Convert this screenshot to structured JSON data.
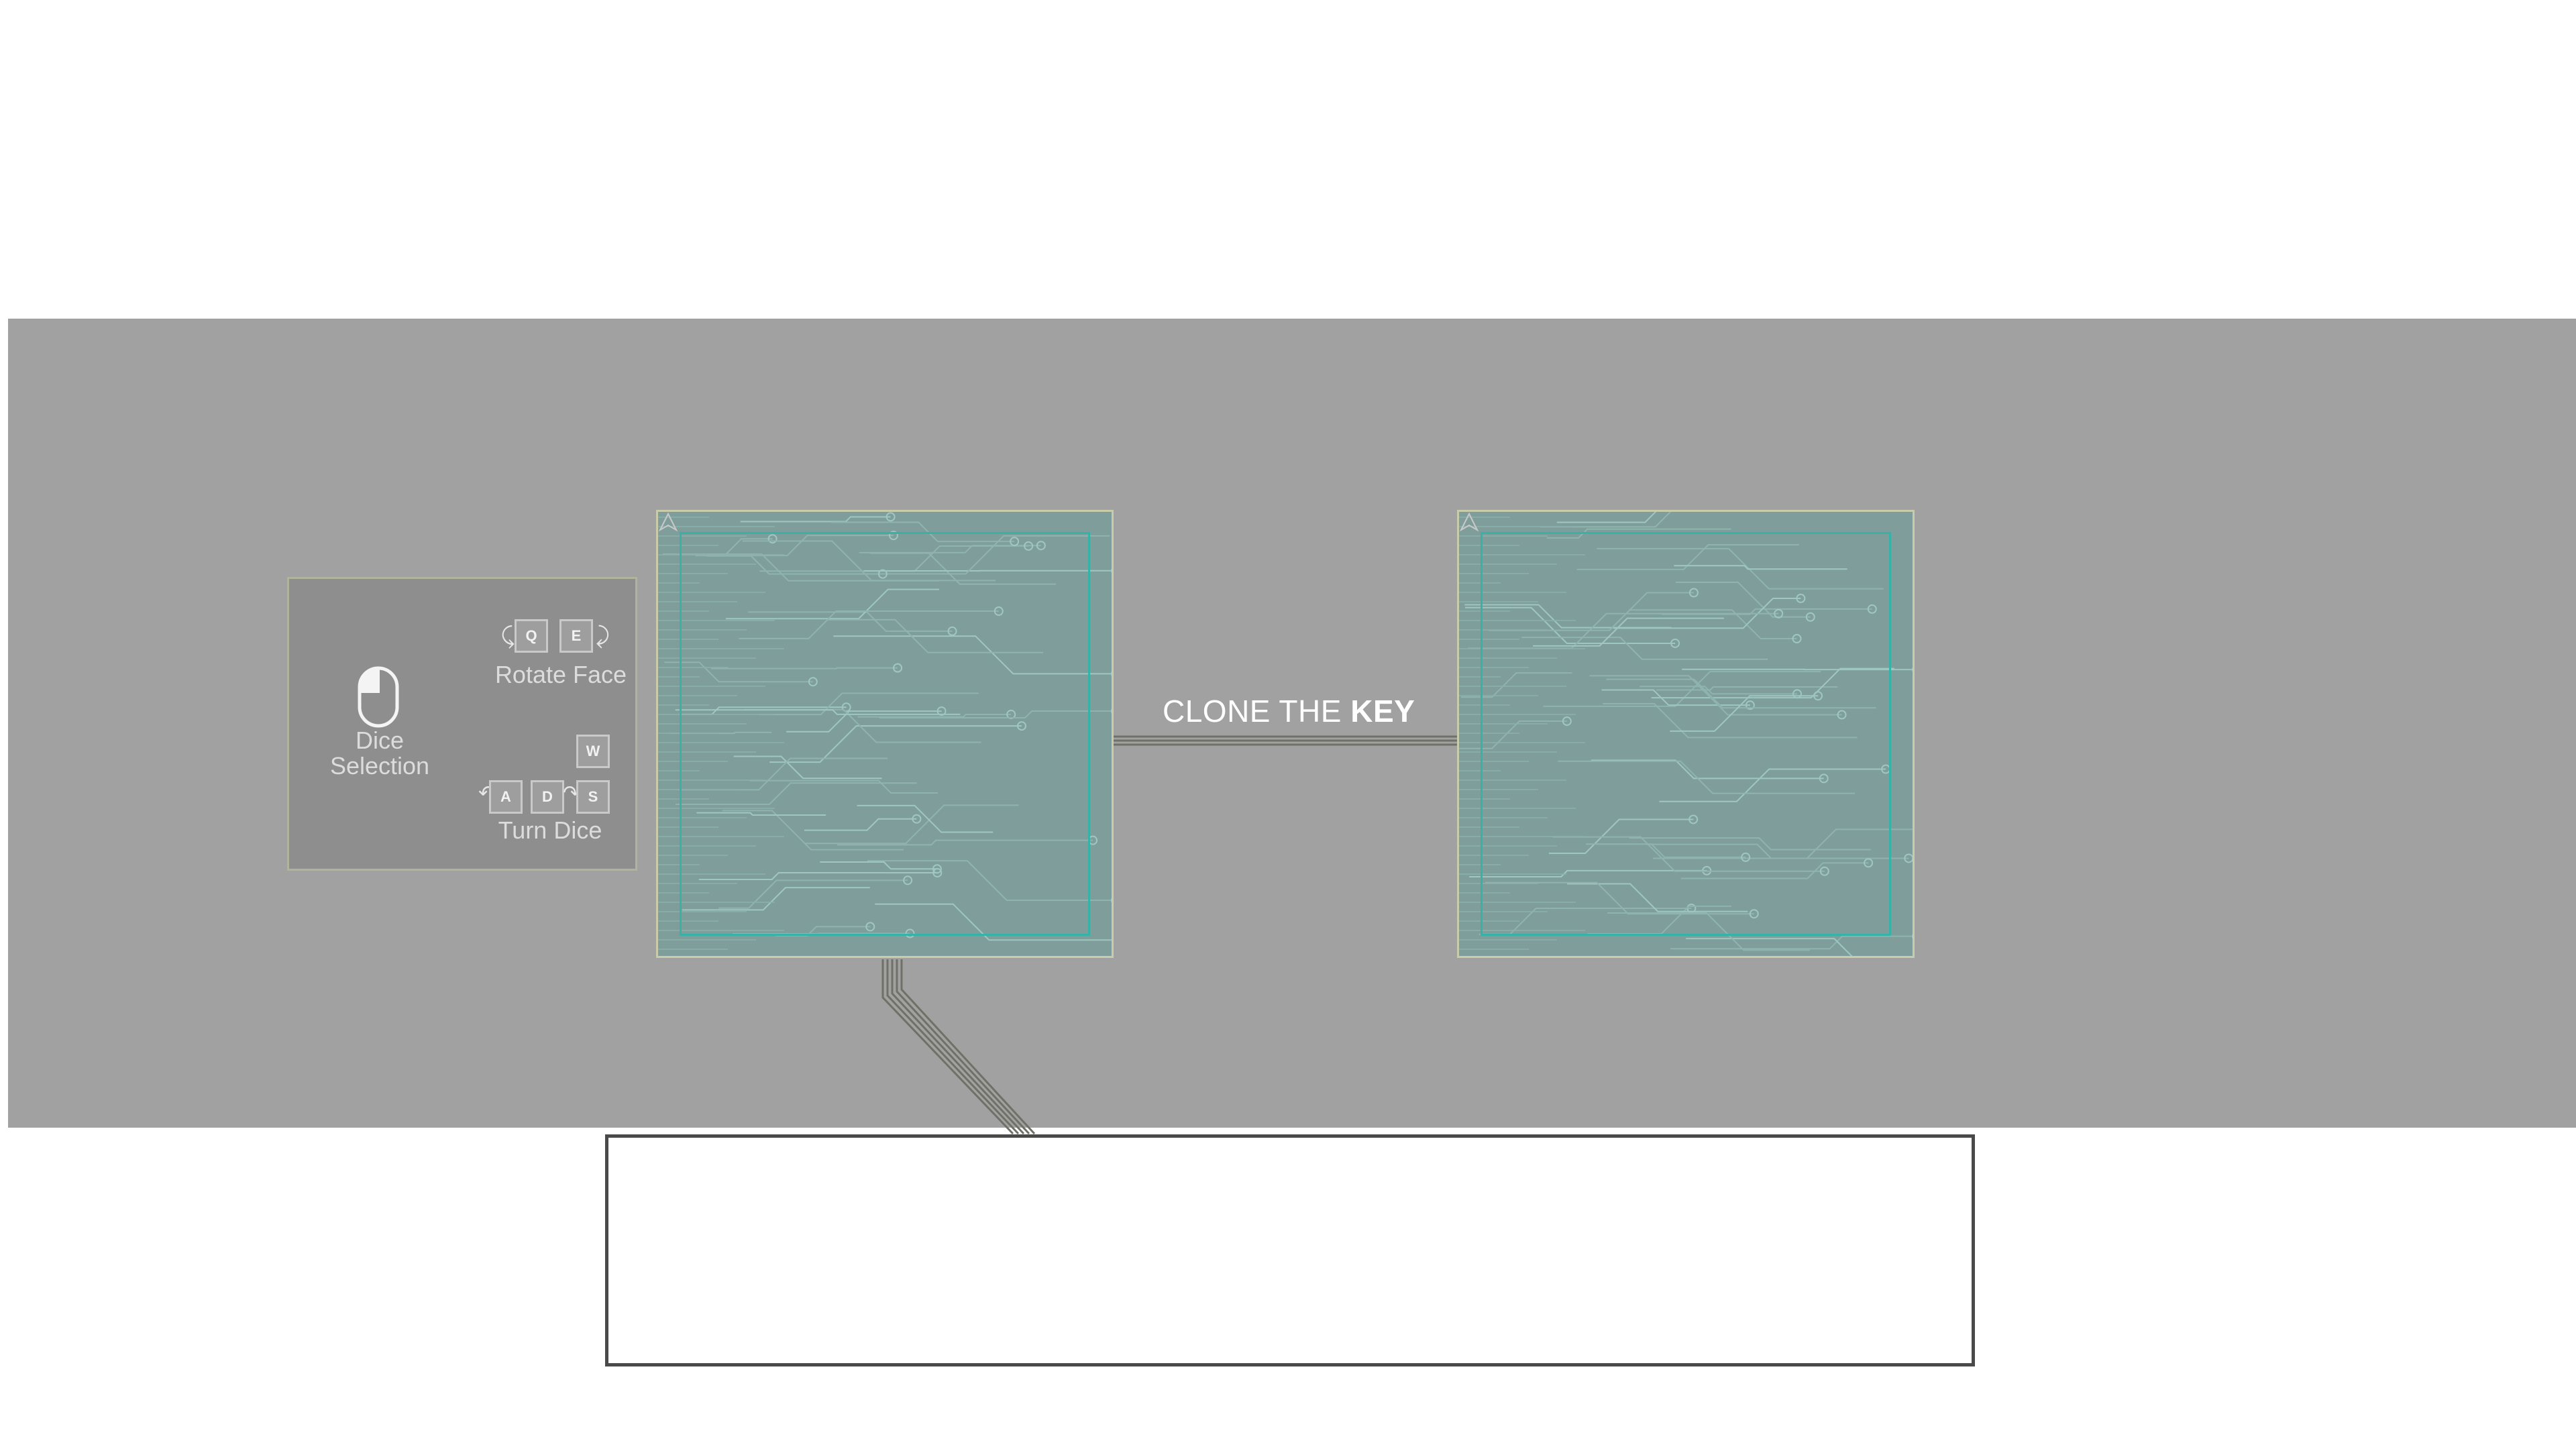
{
  "controls": {
    "rotate_face_label": "Rotate Face",
    "dice_selection_label_line1": "Dice",
    "dice_selection_label_line2": "Selection",
    "turn_dice_label": "Turn Dice",
    "keys": {
      "q": "Q",
      "e": "E",
      "w": "W",
      "a": "A",
      "d": "D",
      "s": "S"
    },
    "mouse_icon": "mouse-left-click-icon"
  },
  "title": {
    "prefix": "CLONE THE ",
    "emphasis": "KEY"
  },
  "boards": [
    {
      "id": "source-board",
      "corner_icon": "triangle-marker-icon"
    },
    {
      "id": "target-board",
      "corner_icon": "triangle-marker-icon"
    }
  ],
  "dialog": {
    "text": ""
  },
  "colors": {
    "stage": "#a1a1a1",
    "panel": "#8e8e8e",
    "board": "#7f9e9b",
    "board_inner_border": "#36b3a7",
    "board_frame": "#c8ccaa",
    "dialog_border": "#4a4a4a"
  }
}
